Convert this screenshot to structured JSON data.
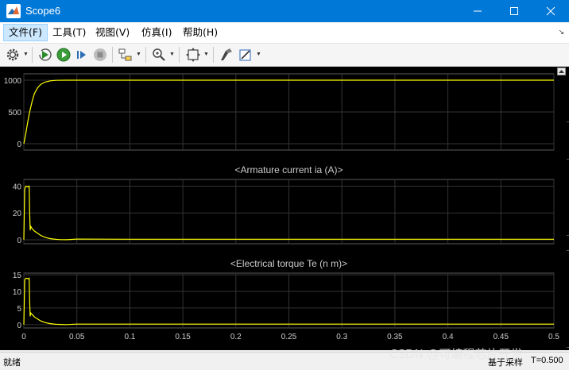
{
  "window": {
    "title": "Scope6",
    "controls": {
      "minimize": "minimize-icon",
      "maximize": "maximize-icon",
      "close": "close-icon"
    }
  },
  "menu": {
    "items": [
      "文件(F)",
      "工具(T)",
      "视图(V)",
      "仿真(I)",
      "帮助(H)"
    ],
    "overflow": "↘"
  },
  "toolbar": {
    "icons": [
      "gear-icon",
      "restore-run-icon",
      "run-icon",
      "step-forward-icon",
      "stop-icon",
      "highlight-block-icon",
      "zoom-icon",
      "autoscale-icon",
      "style-icon",
      "legend-icon"
    ]
  },
  "status": {
    "left": "就绪",
    "sample": "基于采样",
    "time": "T=0.500"
  },
  "watermark": "CSDN @可编程芯片开发",
  "colors": {
    "trace": "#ffff00",
    "background": "#000000",
    "axes": "#333333",
    "text": "#cccccc"
  },
  "chart_data": [
    {
      "type": "line",
      "title": "",
      "xlim": [
        0,
        0.5
      ],
      "ylim": [
        -100,
        1100
      ],
      "yticks": [
        0,
        500,
        1000
      ],
      "ytick_labels": [
        "0",
        "500",
        "1000"
      ],
      "grid": true,
      "series": [
        {
          "x": [
            0,
            0.002,
            0.004,
            0.006,
            0.008,
            0.01,
            0.013,
            0.016,
            0.02,
            0.025,
            0.03,
            0.04,
            0.05,
            0.1,
            0.2,
            0.3,
            0.4,
            0.5
          ],
          "y": [
            0,
            180,
            370,
            540,
            680,
            790,
            880,
            935,
            970,
            990,
            997,
            1000,
            1000,
            1000,
            1000,
            1000,
            1000,
            1000
          ]
        }
      ]
    },
    {
      "type": "line",
      "title": "<Armature current ia (A)>",
      "xlim": [
        0,
        0.5
      ],
      "ylim": [
        -3,
        45
      ],
      "yticks": [
        0,
        20,
        40
      ],
      "ytick_labels": [
        "0",
        "20",
        "40"
      ],
      "grid": true,
      "series": [
        {
          "x": [
            0,
            0.0008,
            0.002,
            0.004,
            0.005,
            0.0055,
            0.006,
            0.0065,
            0.008,
            0.01,
            0.013,
            0.016,
            0.02,
            0.025,
            0.03,
            0.035,
            0.04,
            0.05,
            0.1,
            0.2,
            0.3,
            0.4,
            0.5
          ],
          "y": [
            0,
            38,
            40,
            39.5,
            40,
            20,
            7,
            10,
            8,
            6.5,
            4.8,
            3.2,
            1.8,
            0.8,
            0.3,
            0.1,
            0,
            0.5,
            0.4,
            0.4,
            0.4,
            0.4,
            0.4
          ]
        }
      ]
    },
    {
      "type": "line",
      "title": "<Electrical torque Te (n m)>",
      "xlim": [
        0,
        0.5
      ],
      "ylim": [
        -1,
        15.5
      ],
      "yticks": [
        0,
        5,
        10,
        15
      ],
      "ytick_labels": [
        "0",
        "5",
        "10",
        "15"
      ],
      "xticks": [
        0,
        0.05,
        0.1,
        0.15,
        0.2,
        0.25,
        0.3,
        0.35,
        0.4,
        0.45,
        0.5
      ],
      "xtick_labels": [
        "0",
        "0.05",
        "0.1",
        "0.15",
        "0.2",
        "0.25",
        "0.3",
        "0.35",
        "0.4",
        "0.45",
        "0.5"
      ],
      "grid": true,
      "series": [
        {
          "x": [
            0,
            0.0008,
            0.002,
            0.004,
            0.005,
            0.0055,
            0.006,
            0.0065,
            0.008,
            0.01,
            0.013,
            0.016,
            0.02,
            0.025,
            0.03,
            0.035,
            0.04,
            0.05,
            0.1,
            0.2,
            0.3,
            0.4,
            0.5
          ],
          "y": [
            0,
            13.5,
            14,
            13.8,
            14,
            7,
            2.5,
            3.5,
            3,
            2.3,
            1.7,
            1.1,
            0.6,
            0.3,
            0.1,
            0.05,
            0,
            0.15,
            0.15,
            0.15,
            0.15,
            0.15,
            0.15
          ]
        }
      ]
    }
  ]
}
